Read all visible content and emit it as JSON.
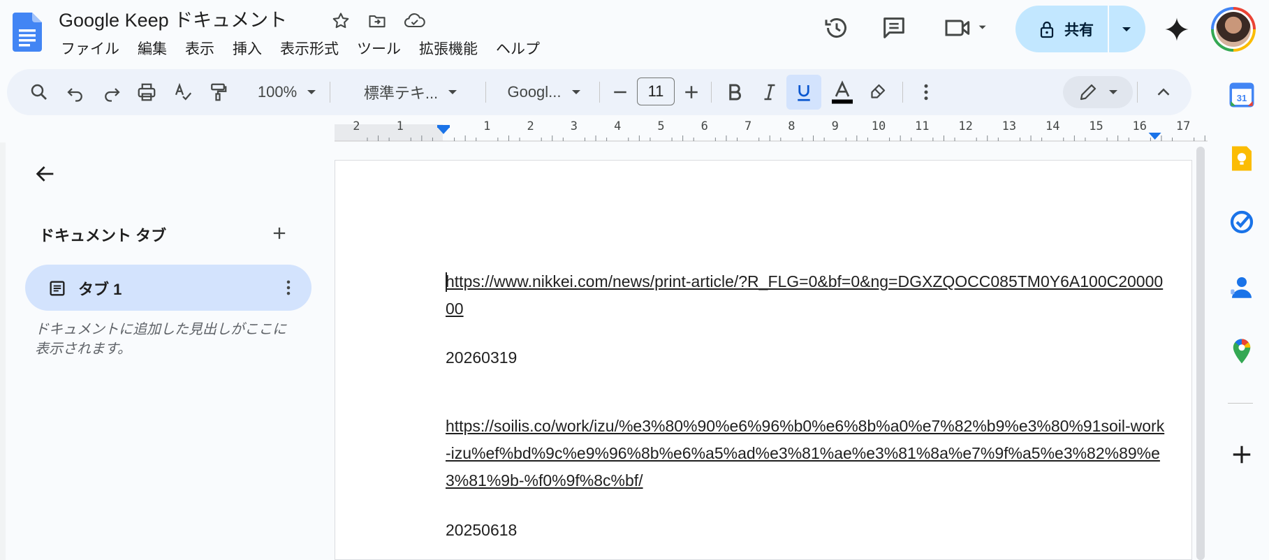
{
  "app": {
    "title": "Google Keep ドキュメント"
  },
  "menu": {
    "items": [
      "ファイル",
      "編集",
      "表示",
      "挿入",
      "表示形式",
      "ツール",
      "拡張機能",
      "ヘルプ"
    ]
  },
  "header": {
    "share_label": "共有"
  },
  "toolbar": {
    "zoom": "100%",
    "style": "標準テキ...",
    "font": "Googl...",
    "font_size": "11"
  },
  "ruler": {
    "left_labels": [
      "2",
      "1"
    ],
    "labels": [
      "1",
      "2",
      "3",
      "4",
      "5",
      "6",
      "7",
      "8",
      "9",
      "10",
      "11",
      "12",
      "13",
      "14",
      "15",
      "16",
      "17"
    ]
  },
  "left_pane": {
    "heading": "ドキュメント タブ",
    "tabs": [
      {
        "label": "タブ 1"
      }
    ],
    "hint": "ドキュメントに追加した見出しがここに表示されます。"
  },
  "document": {
    "paragraphs": [
      {
        "text": "https://www.nikkei.com/news/print-article/?R_FLG=0&bf=0&ng=DGXZQOCC085TM0Y6A100C2000000",
        "link": true
      },
      {
        "text": "20260319",
        "link": false
      },
      {
        "text": "https://soilis.co/work/izu/%e3%80%90%e6%96%b0%e6%8b%a0%e7%82%b9%e3%80%91soil-work-izu%ef%bd%9c%e9%96%8b%e6%a5%ad%e3%81%ae%e3%81%8a%e7%9f%a5%e3%82%89%e3%81%9b-%f0%9f%8c%bf/",
        "link": true
      },
      {
        "text": "20250618",
        "link": false
      }
    ]
  },
  "colors": {
    "accent": "#0b57d0",
    "share_bg": "#c2e7ff",
    "toolbar_bg": "#edf2fa",
    "tab_active_bg": "#d3e3fd"
  },
  "icons": {
    "header": [
      "star-icon",
      "move-icon",
      "cloud-saved-icon",
      "history-icon",
      "comment-icon",
      "video-icon",
      "lock-icon",
      "gemini-icon"
    ],
    "toolbar": [
      "search-icon",
      "undo-icon",
      "redo-icon",
      "print-icon",
      "spellcheck-icon",
      "paint-format-icon",
      "minus-icon",
      "plus-icon",
      "bold-icon",
      "italic-icon",
      "underline-icon",
      "text-color-icon",
      "highlight-icon",
      "more-vert-icon",
      "edit-pencil-icon",
      "chevron-up-icon"
    ],
    "side_apps": [
      "calendar-icon",
      "keep-icon",
      "tasks-icon",
      "contacts-icon",
      "maps-icon",
      "add-icon"
    ]
  }
}
